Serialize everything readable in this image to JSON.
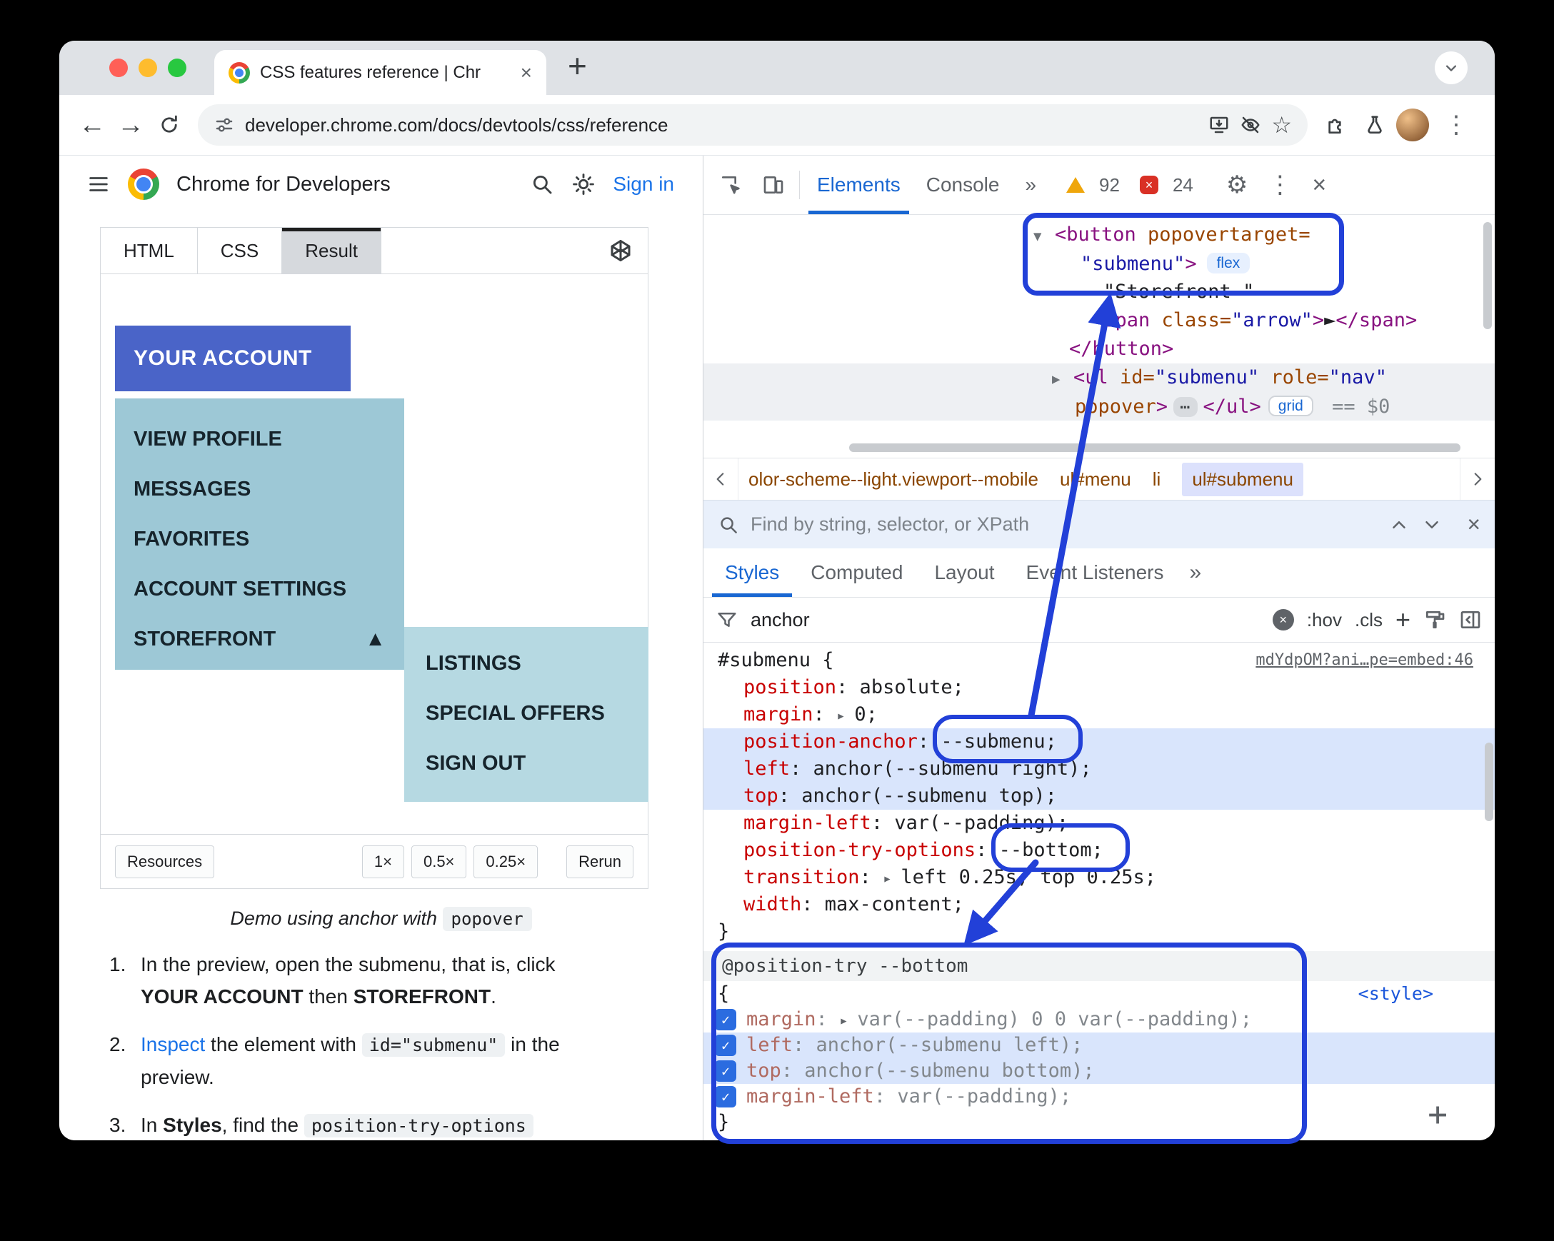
{
  "colors": {
    "annotation_blue": "#2240d8",
    "account_button": "#4a64c8",
    "menu_bg": "#9dc8d6",
    "submenu_bg": "#b6d9e2",
    "filter_highlight": "#d9e5fc",
    "devtools_accent": "#1967d2"
  },
  "glyphs": {
    "tab_close": "×",
    "new_tab": "+",
    "back": "←",
    "forward": "→",
    "kebab": "⋮",
    "gear": "⚙",
    "close": "×",
    "star": "☆",
    "check": "✓",
    "clear": "×",
    "find_close": "×",
    "warning_count_sep": ""
  },
  "browser": {
    "tab_title": "CSS features reference | Chr",
    "url": "developer.chrome.com/docs/devtools/css/reference"
  },
  "site": {
    "brand": "Chrome for Developers",
    "sign_in": "Sign in",
    "demo_tabs": {
      "html": "HTML",
      "css": "CSS",
      "result": "Result"
    },
    "demo": {
      "account_button": "YOUR ACCOUNT",
      "menu_items": [
        "VIEW PROFILE",
        "MESSAGES",
        "FAVORITES",
        "ACCOUNT SETTINGS",
        "STOREFRONT"
      ],
      "storefront_arrow": "▲",
      "submenu_items": [
        "LISTINGS",
        "SPECIAL OFFERS",
        "SIGN OUT"
      ]
    },
    "footer": {
      "resources": "Resources",
      "scales": [
        "1×",
        "0.5×",
        "0.25×"
      ],
      "rerun": "Rerun"
    },
    "caption": {
      "pre": "Demo using anchor with ",
      "code": "popover"
    },
    "steps": {
      "n1": "1.",
      "s1a": "In the preview, open the submenu, that is, click ",
      "s1b": "YOUR ACCOUNT",
      "s1c": " then ",
      "s1d": "STOREFRONT",
      "s1e": ".",
      "n2": "2.",
      "s2a": "Inspect",
      "s2b": " the element with ",
      "s2c": "id=\"submenu\"",
      "s2d": " in the preview.",
      "n3": "3.",
      "s3a": "In ",
      "s3b": "Styles",
      "s3c": ", find the ",
      "s3d": "position-try-options"
    }
  },
  "devtools": {
    "tabs": {
      "elements": "Elements",
      "console": "Console",
      "more": "»"
    },
    "counts": {
      "warnings": "92",
      "errors": "24",
      "error_x": "×"
    },
    "dom_lines": [
      [
        {
          "t": "▼ ",
          "c": "caret"
        },
        {
          "t": "<button ",
          "c": "tag"
        },
        {
          "t": "popovertarget=",
          "c": "attr"
        }
      ],
      [
        {
          "t": "\"submenu\"",
          "c": "val"
        },
        {
          "t": ">",
          "c": "tag"
        },
        {
          "t": "flex",
          "c": "badge"
        }
      ],
      [
        {
          "t": "\"Storefront \"",
          "c": "txt"
        }
      ],
      [
        {
          "t": "<span ",
          "c": "tag"
        },
        {
          "t": "class=",
          "c": "attr"
        },
        {
          "t": "\"arrow\"",
          "c": "val"
        },
        {
          "t": ">",
          "c": "tag"
        },
        {
          "t": "►",
          "c": "txt"
        },
        {
          "t": "</span>",
          "c": "tag"
        }
      ],
      [
        {
          "t": "</button>",
          "c": "tag"
        }
      ],
      [
        {
          "t": "▶ ",
          "c": "caret"
        },
        {
          "t": "<ul ",
          "c": "tag"
        },
        {
          "t": "id=",
          "c": "attr"
        },
        {
          "t": "\"submenu\"",
          "c": "val"
        },
        {
          "t": " ",
          "c": "txt"
        },
        {
          "t": "role=",
          "c": "attr"
        },
        {
          "t": "\"nav\"",
          "c": "val"
        }
      ],
      [
        {
          "t": "popover",
          "c": "attr"
        },
        {
          "t": ">",
          "c": "tag"
        },
        {
          "t": "⋯",
          "c": "edots"
        },
        {
          "t": "</ul>",
          "c": "tag"
        },
        {
          "t": "grid",
          "c": "badge2"
        },
        {
          "t": " == $0",
          "c": "eq"
        }
      ]
    ],
    "crumbs": [
      "olor-scheme--light.viewport--mobile",
      "ul#menu",
      "li",
      "ul#submenu"
    ],
    "find_placeholder": "Find by string, selector, or XPath",
    "styles_tabs": [
      "Styles",
      "Computed",
      "Layout",
      "Event Listeners"
    ],
    "styles_more": "»",
    "filter": {
      "value": "anchor",
      "hov": ":hov",
      "cls": ".cls",
      "plus": "+"
    },
    "rule": {
      "selector": [
        {
          "t": "#submenu",
          "c": "selr"
        },
        {
          "t": " {",
          "c": "code"
        }
      ],
      "source_link": "mdYdpOM?ani…pe=embed:46",
      "rows": [
        [
          {
            "t": "position",
            "c": "prop"
          },
          {
            "t": ": absolute;",
            "c": "code"
          }
        ],
        [
          {
            "t": "margin",
            "c": "prop"
          },
          {
            "t": ": ",
            "c": "code"
          },
          {
            "t": "▸ ",
            "c": "tri"
          },
          {
            "t": "0;",
            "c": "code"
          }
        ],
        [
          {
            "t": "position-anchor",
            "c": "prop"
          },
          {
            "t": ": ",
            "c": "code"
          },
          {
            "t": "--submenu;",
            "c": "code"
          }
        ],
        [
          {
            "t": "left",
            "c": "prop"
          },
          {
            "t": ": anchor(--submenu right);",
            "c": "code"
          }
        ],
        [
          {
            "t": "top",
            "c": "prop"
          },
          {
            "t": ": anchor(--submenu top);",
            "c": "code"
          }
        ],
        [
          {
            "t": "margin-left",
            "c": "prop"
          },
          {
            "t": ": var(--padding);",
            "c": "code"
          }
        ],
        [
          {
            "t": "position-try-options",
            "c": "prop"
          },
          {
            "t": ": ",
            "c": "code"
          },
          {
            "t": "--bottom;",
            "c": "code"
          }
        ],
        [
          {
            "t": "transition",
            "c": "prop"
          },
          {
            "t": ": ",
            "c": "code"
          },
          {
            "t": "▸ ",
            "c": "tri"
          },
          {
            "t": "left 0.25s, top 0.25s;",
            "c": "code"
          }
        ],
        [
          {
            "t": "width",
            "c": "prop"
          },
          {
            "t": ": max-content;",
            "c": "code"
          }
        ]
      ],
      "close": "}"
    },
    "attry": {
      "header": "@position-try --bottom",
      "open": "{",
      "style_link": "<style>",
      "rows": [
        [
          {
            "t": "margin",
            "c": "dprop"
          },
          {
            "t": ": ",
            "c": "dval"
          },
          {
            "t": "▸ ",
            "c": "tri"
          },
          {
            "t": "var(--padding) 0 0 var(--padding);",
            "c": "dval"
          }
        ],
        [
          {
            "t": "left",
            "c": "dprop"
          },
          {
            "t": ": anchor(--submenu left);",
            "c": "dval"
          }
        ],
        [
          {
            "t": "top",
            "c": "dprop"
          },
          {
            "t": ": anchor(--submenu bottom);",
            "c": "dval"
          }
        ],
        [
          {
            "t": "margin-left",
            "c": "dprop"
          },
          {
            "t": ": var(--padding);",
            "c": "dval"
          }
        ]
      ],
      "close": "}"
    },
    "add_rule": "+"
  }
}
